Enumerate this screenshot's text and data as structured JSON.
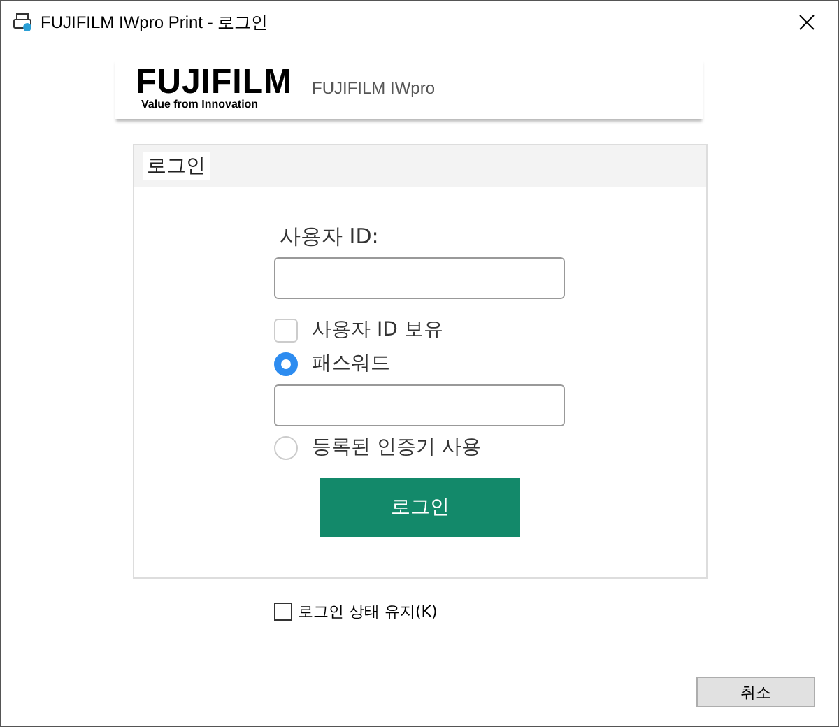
{
  "window": {
    "title": "FUJIFILM IWpro Print - 로그인"
  },
  "brand": {
    "logo": "FUJIFILM",
    "tagline": "Value from Innovation",
    "product": "FUJIFILM IWpro"
  },
  "panel": {
    "title": "로그인",
    "user_id": {
      "label": "사용자 ID:"
    },
    "remember_id": {
      "label": "사용자 ID 보유",
      "checked": false
    },
    "methods": [
      {
        "kind": "password",
        "label": "패스워드",
        "selected": true
      },
      {
        "kind": "authenticator",
        "label": "등록된 인증기 사용",
        "selected": false
      }
    ],
    "login_button": "로그인"
  },
  "keep_login": {
    "label": "로그인 상태 유지(K)",
    "checked": false
  },
  "buttons": [
    {
      "label": "취소"
    }
  ]
}
